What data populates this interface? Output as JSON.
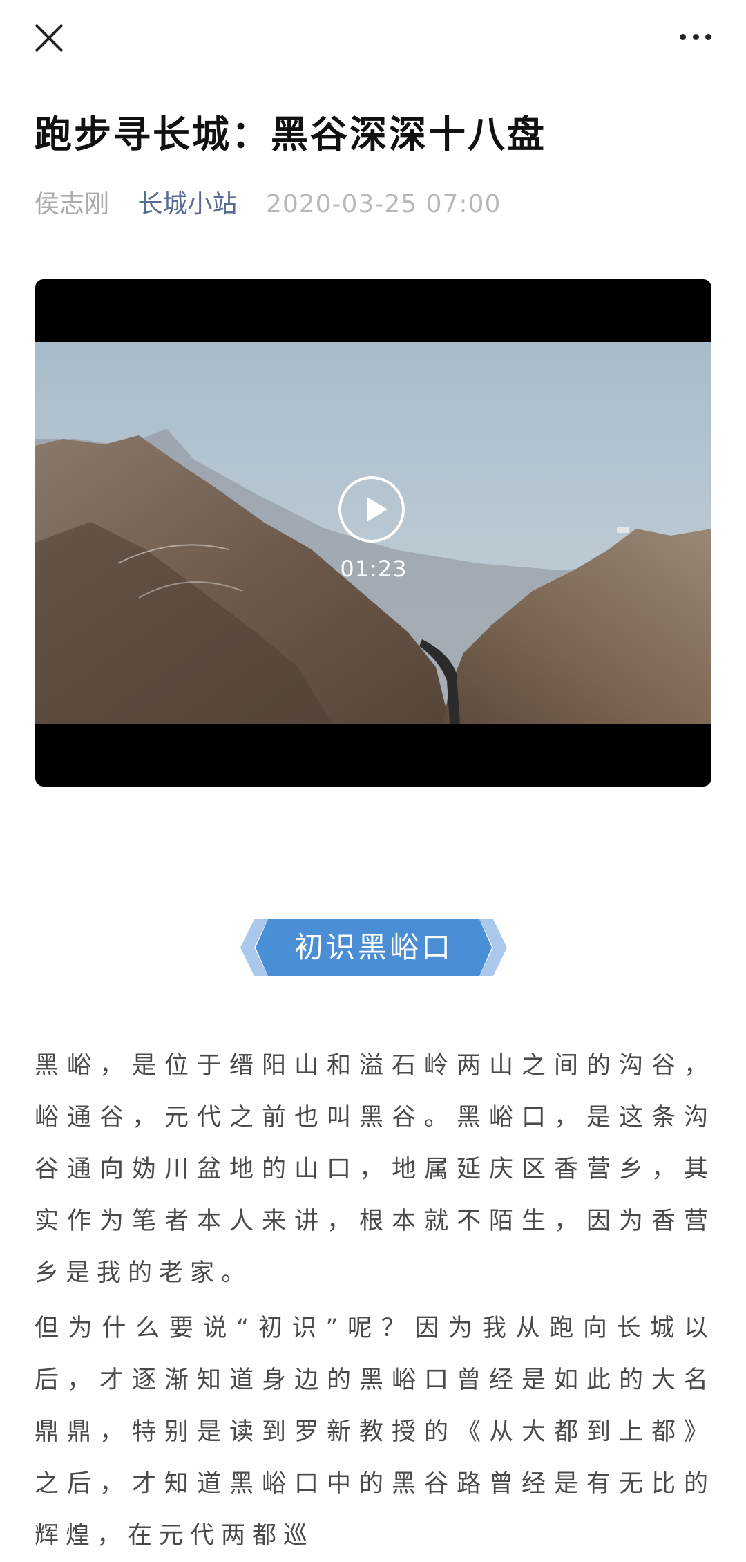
{
  "topbar": {
    "close_icon": "close-icon",
    "more_icon": "more-dots-icon"
  },
  "article": {
    "title": "跑步寻长城：黑谷深深十八盘",
    "author": "侯志刚",
    "account": "长城小站",
    "date": "2020-03-25 07:00"
  },
  "video": {
    "duration": "01:23",
    "play_icon": "play-icon"
  },
  "section": {
    "title": "初识黑峪口",
    "accent_color": "#4a8fd6"
  },
  "paragraphs": [
    "黑峪，是位于缙阳山和溢石岭两山之间的沟谷，峪通谷，元代之前也叫黑谷。黑峪口，是这条沟谷通向妫川盆地的山口，地属延庆区香营乡，其实作为笔者本人来讲，根本就不陌生，因为香营乡是我的老家。",
    "但为什么要说“初识”呢？因为我从跑向长城以后，才逐渐知道身边的黑峪口曾经是如此的大名鼎鼎，特别是读到罗新教授的《从大都到上都》之后，才知道黑峪口中的黑谷路曾经是有无比的辉煌，在元代两都巡"
  ]
}
